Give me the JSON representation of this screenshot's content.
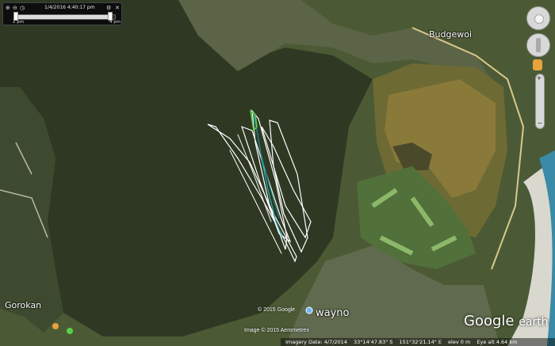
{
  "time_slider": {
    "date_time": "1/4/2016   4:40:17 pm",
    "start_label": "2 pm",
    "end_label": "4 pm",
    "position_fraction": 0.95,
    "icons": [
      "zoom-in-icon",
      "zoom-out-icon",
      "clock-icon",
      "settings-icon",
      "close-icon"
    ]
  },
  "places": {
    "budgewoi": "Budgewoi",
    "gorokan": "Gorokan",
    "wayno": "wayno"
  },
  "copyrights": {
    "google": "© 2015 Google",
    "image": "Image © 2015 Aerometrex"
  },
  "logo": {
    "google": "Google",
    "earth": "earth"
  },
  "status": {
    "imagery_date": "Imagery Date: 4/7/2014",
    "lat": "33°14'47.83\" S",
    "lon": "151°32'21.14\" E",
    "elev": "elev   0 m",
    "eye": "Eye alt   4.64 km"
  },
  "colors": {
    "water": "#2f3823",
    "swamp": "#8a7a3a",
    "track_white": "#ffffff",
    "track_cyan": "#29b0b8",
    "track_green": "#5ad04a"
  }
}
